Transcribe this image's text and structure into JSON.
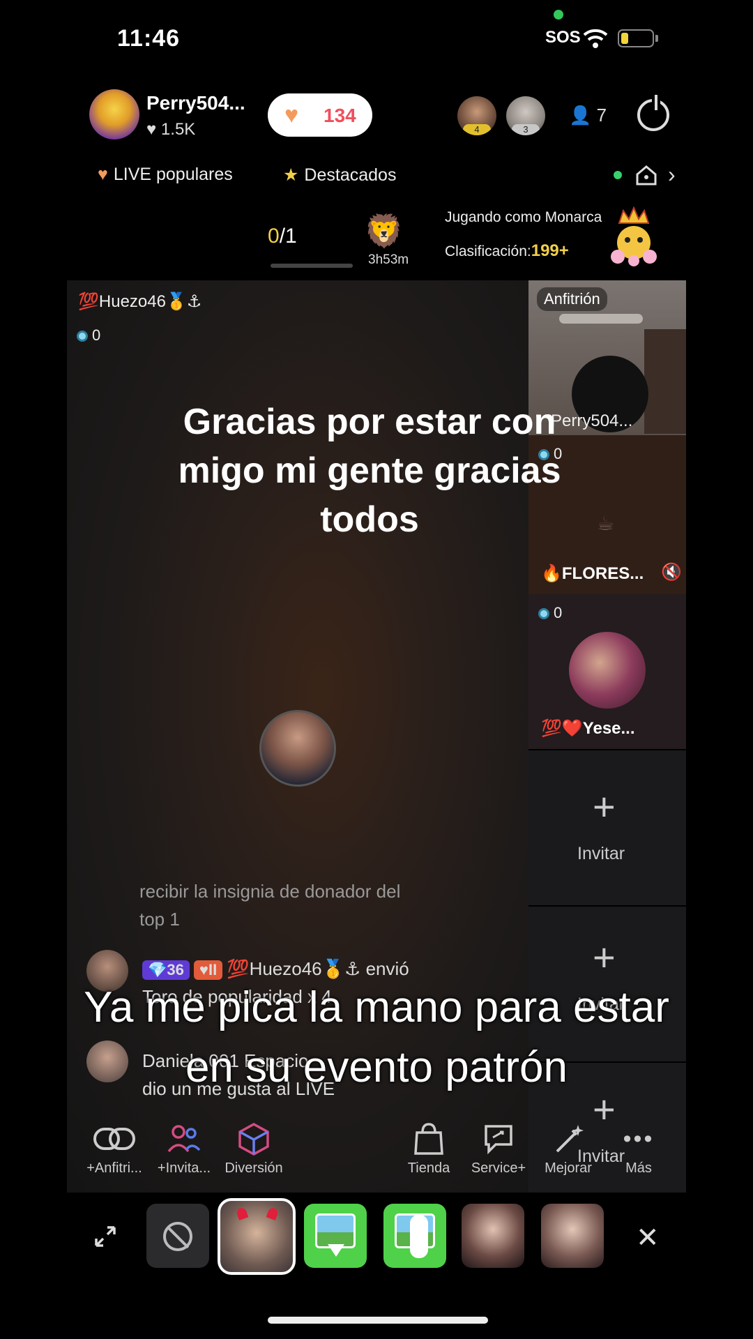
{
  "status": {
    "time": "11:46",
    "sos": "SOS"
  },
  "header": {
    "host_name": "Perry504...",
    "host_likes": "1.5K",
    "like_count": "134",
    "viewer1_rank": "4",
    "viewer2_rank": "3",
    "viewer_count": "7"
  },
  "tabs": {
    "popular": "LIVE populares",
    "featured": "Destacados"
  },
  "game": {
    "progress_done": "0",
    "progress_total": "/1",
    "timer": "3h53m",
    "monarca": "Jugando como Monarca",
    "rank_label": "Clasificación:",
    "rank_value": "199+"
  },
  "stage": {
    "user": "Huezo46",
    "count": "0",
    "caption": "Gracias por estar con migo mi gente gracias todos"
  },
  "side": {
    "host_label": "Anfitrión",
    "host_tag": "Perry504...",
    "slot2_count": "0",
    "slot2_name": "FLORES...",
    "slot3_count": "0",
    "slot3_name": "Yese...",
    "invite": "Invitar"
  },
  "chat": {
    "msg1_line1": "recibir la insignia de donador del",
    "msg1_line2": "top 1",
    "level_badge": "36",
    "fan_badge": "II",
    "msg2_user": "Huezo46",
    "msg2_action": "envió",
    "msg2_line2": "Toro de popularidad x 4",
    "msg3_line1": "Daniela 001 Espacio",
    "msg3_line2": "dio un me gusta al LIVE"
  },
  "subtitle": "Ya me pica la mano para estar en su evento patrón",
  "toolbar": {
    "cohost": "+Anfitri...",
    "invite": "+Invita...",
    "fun": "Diversión",
    "shop": "Tienda",
    "service": "Service+",
    "enhance": "Mejorar",
    "more": "Más"
  },
  "colors": {
    "like": "#f04f5e",
    "accent_yellow": "#f1cf4a",
    "green_effect": "#4fd149"
  }
}
